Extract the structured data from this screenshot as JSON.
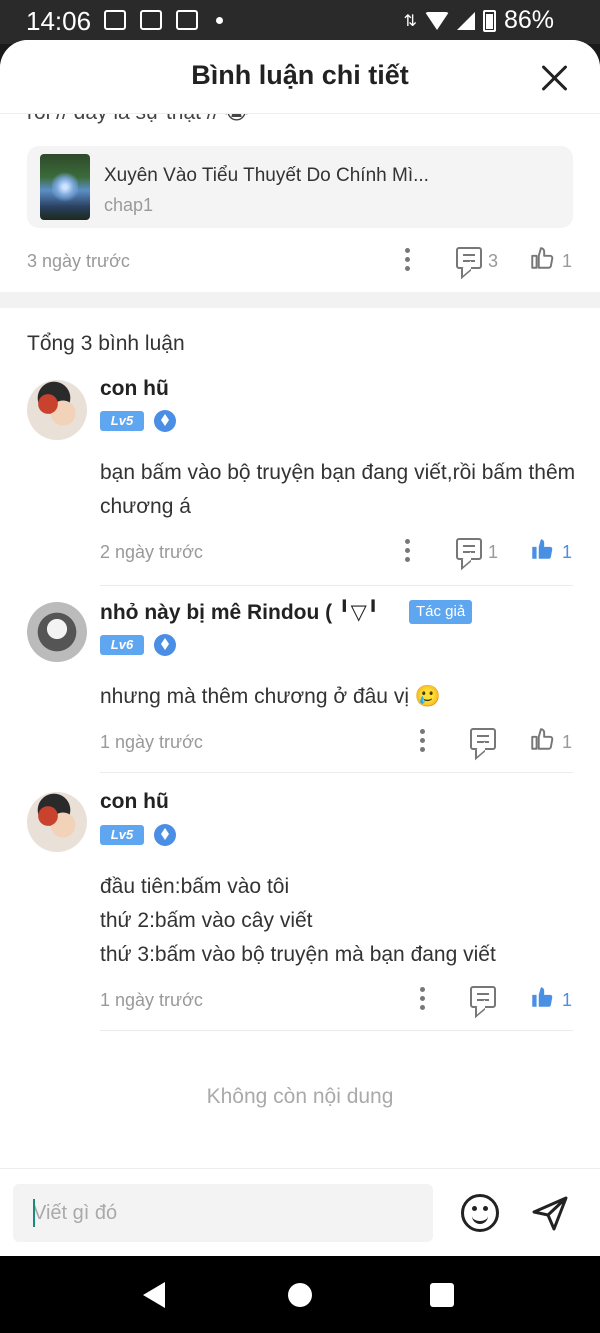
{
  "status_bar": {
    "time": "14:06",
    "battery": "86%",
    "left_icons": [
      "message-icon",
      "image-icon",
      "photo-off-icon",
      "dot-icon"
    ],
    "right_icons": [
      "data-arrows-icon",
      "wifi-icon",
      "signal-icon",
      "battery-icon"
    ]
  },
  "header": {
    "title": "Bình luận chi tiết",
    "close_icon": "close-icon"
  },
  "parent_comment": {
    "partial_text": "rồi // đây là sự thật // 😭",
    "book": {
      "title": "Xuyên Vào Tiểu Thuyết Do Chính Mì...",
      "chapter": "chap1"
    },
    "time": "3 ngày trước",
    "reply_count": "3",
    "like_count": "1"
  },
  "total_label": "Tổng 3 bình luận",
  "comments": [
    {
      "name": "con hũ",
      "level": "Lv5",
      "text": "bạn bấm vào bộ truyện bạn đang viết,rồi bấm thêm chương á",
      "time": "2 ngày trước",
      "reply_count": "1",
      "like_count": "1",
      "liked": true
    },
    {
      "name": "nhỏ này bị mê Rindou ( ╹▽╹",
      "author_badge": "Tác giả",
      "level": "Lv6",
      "text": "nhưng mà thêm chương ở đâu vị 🥲",
      "time": "1 ngày trước",
      "like_count": "1",
      "liked": false
    },
    {
      "name": "con hũ",
      "level": "Lv5",
      "text_lines": [
        "đầu tiên:bấm vào tôi",
        "thứ 2:bấm vào cây viết",
        "thứ 3:bấm vào bộ truyện mà bạn đang viết"
      ],
      "time": "1 ngày trước",
      "like_count": "1",
      "liked": true
    }
  ],
  "no_more": "Không còn nội dung",
  "input": {
    "placeholder": "Viết gì đó"
  },
  "colors": {
    "accent": "#5ea6f0",
    "like_active": "#4a90e2",
    "muted": "#999999"
  }
}
